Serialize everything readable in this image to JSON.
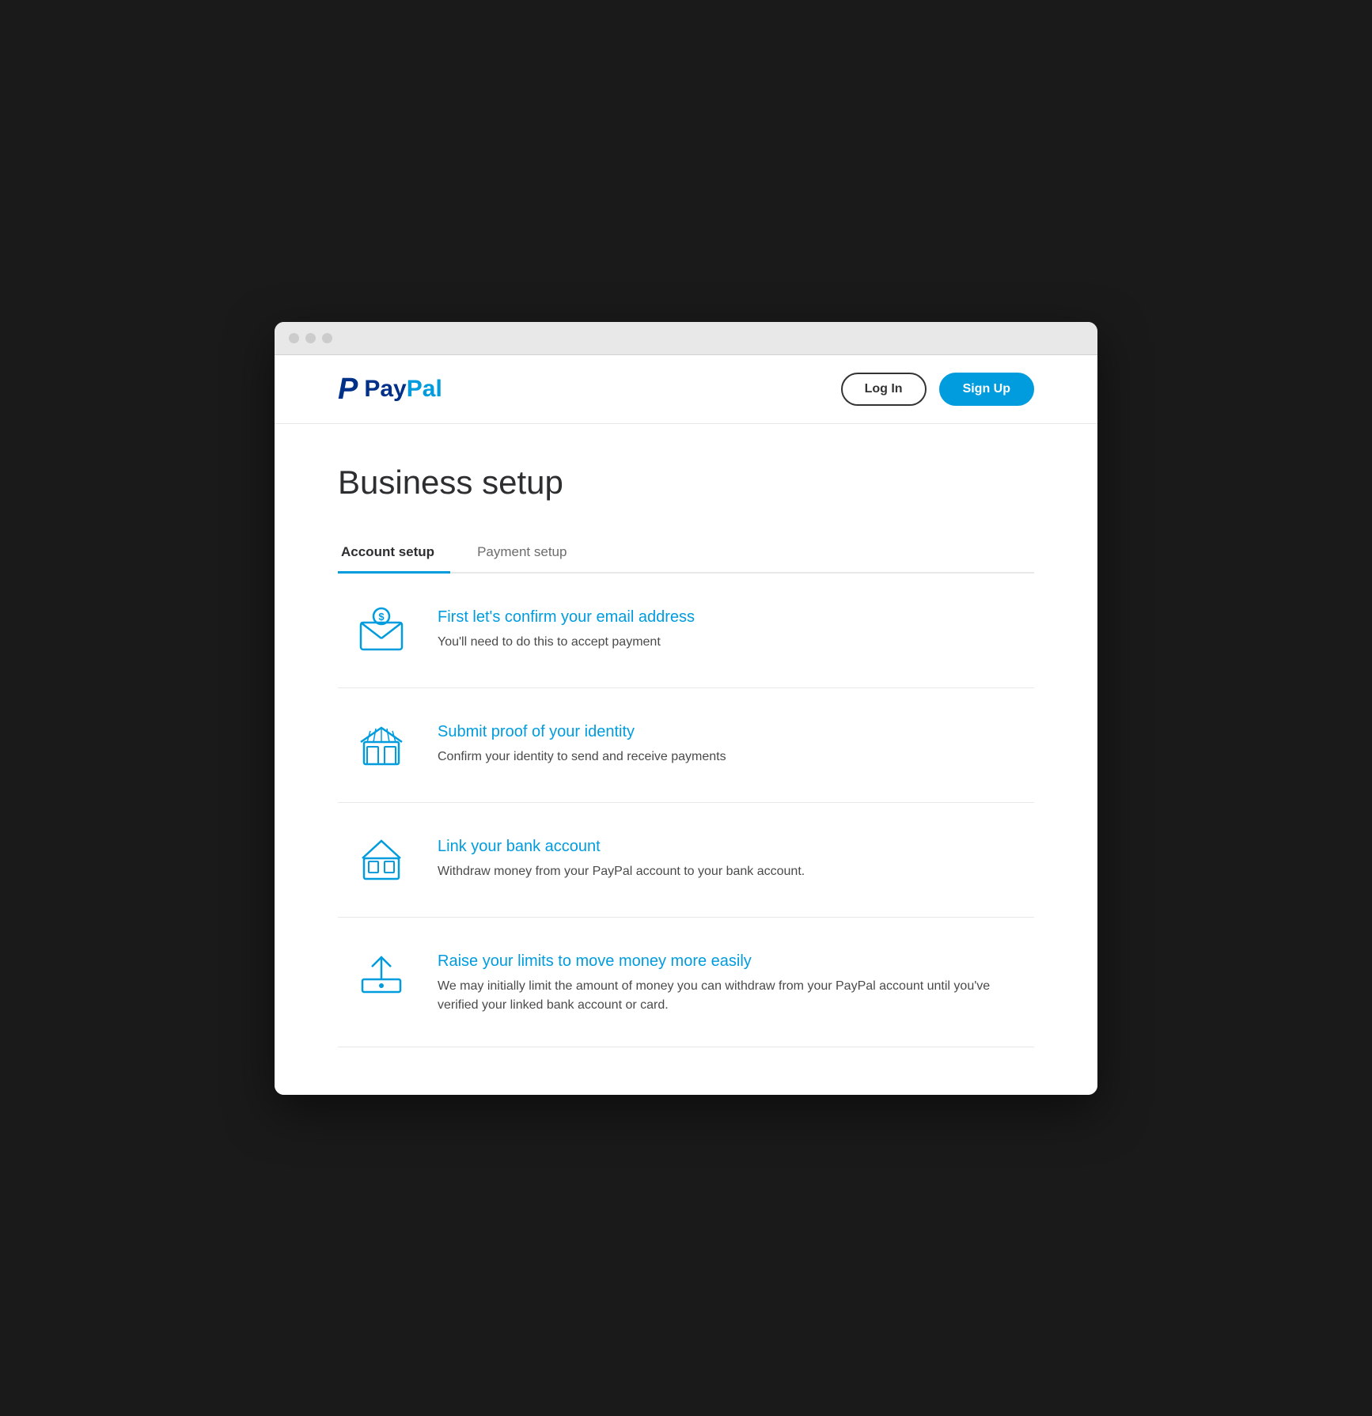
{
  "browser": {
    "dots": [
      "dot1",
      "dot2",
      "dot3"
    ]
  },
  "header": {
    "logo_p": "P",
    "logo_pay": "Pay",
    "logo_pal": "Pal",
    "login_label": "Log In",
    "signup_label": "Sign Up"
  },
  "page": {
    "title": "Business setup"
  },
  "tabs": [
    {
      "id": "account-setup",
      "label": "Account setup",
      "active": true
    },
    {
      "id": "payment-setup",
      "label": "Payment setup",
      "active": false
    }
  ],
  "steps": [
    {
      "id": "confirm-email",
      "title": "First let's confirm your email address",
      "description": "You'll need to do this to accept payment",
      "icon": "email"
    },
    {
      "id": "submit-identity",
      "title": "Submit proof of your identity",
      "description": "Confirm your identity to send and receive payments",
      "icon": "store"
    },
    {
      "id": "link-bank",
      "title": "Link your bank account",
      "description": "Withdraw money from your PayPal account to your bank account.",
      "icon": "bank"
    },
    {
      "id": "raise-limits",
      "title": "Raise your limits to move money more easily",
      "description": "We may initially limit the amount of money you can withdraw from your PayPal account until you've verified your linked bank account or card.",
      "icon": "upload"
    }
  ],
  "colors": {
    "accent": "#009cde",
    "dark_blue": "#003087",
    "text_dark": "#2c2e2f",
    "text_gray": "#4a4a4a"
  }
}
